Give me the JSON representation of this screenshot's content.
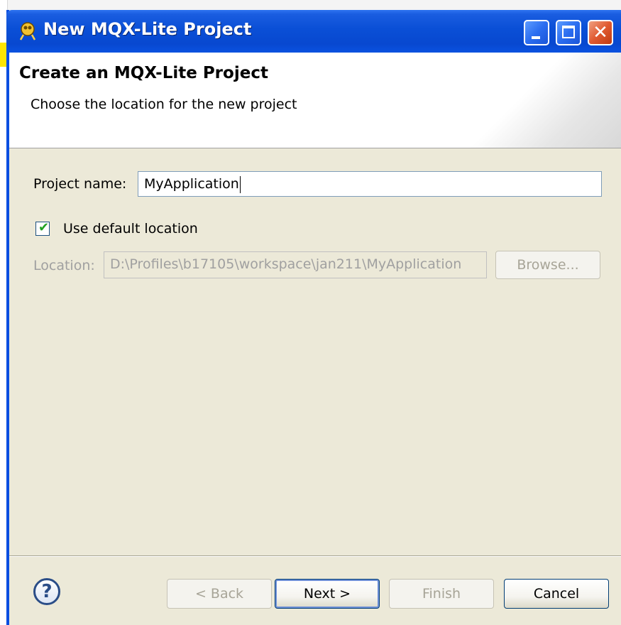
{
  "window": {
    "title": "New MQX-Lite Project"
  },
  "banner": {
    "title": "Create an MQX-Lite Project",
    "description": "Choose the location for the new project"
  },
  "form": {
    "project_name_label": "Project name:",
    "project_name_value": "MyApplication",
    "use_default_location_label": "Use default location",
    "use_default_location_checked": true,
    "location_label": "Location:",
    "location_value": "D:\\Profiles\\b17105\\workspace\\jan211\\MyApplication",
    "browse_label": "Browse..."
  },
  "buttons": {
    "back_label": "< Back",
    "next_label": "Next >",
    "finish_label": "Finish",
    "cancel_label": "Cancel"
  },
  "icons": {
    "app": "eclipse-wizard-icon",
    "help": "help-icon",
    "checkmark": "checkmark-icon"
  },
  "colors": {
    "titlebar": "#0a4fd6",
    "dialog_bg": "#ece9d8",
    "checkmark": "#21a121"
  }
}
